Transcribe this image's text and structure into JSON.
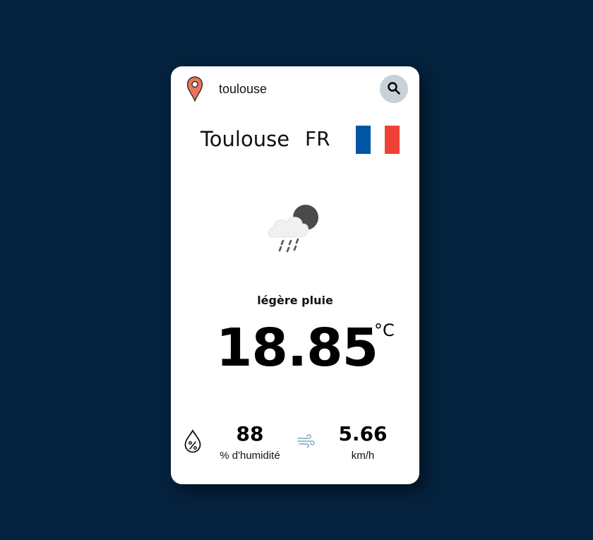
{
  "search": {
    "value": "toulouse",
    "icon": "search-icon",
    "button_color": "#c7d1d8"
  },
  "location": {
    "icon": "map-pin-icon",
    "city": "Toulouse",
    "country_code": "FR",
    "flag_colors": [
      "#0055a4",
      "#ffffff",
      "#ef4135"
    ]
  },
  "weather": {
    "icon": "cloud-rain-night-icon",
    "description": "légère pluie",
    "temperature": "18.85",
    "unit": "°C"
  },
  "humidity": {
    "icon": "humidity-drop-icon",
    "value": "88",
    "label": "% d'humidité"
  },
  "wind": {
    "icon": "wind-icon",
    "value": "5.66",
    "label": "km/h"
  },
  "colors": {
    "background": "#04223d",
    "card": "#ffffff",
    "pin": "#e8765c"
  }
}
